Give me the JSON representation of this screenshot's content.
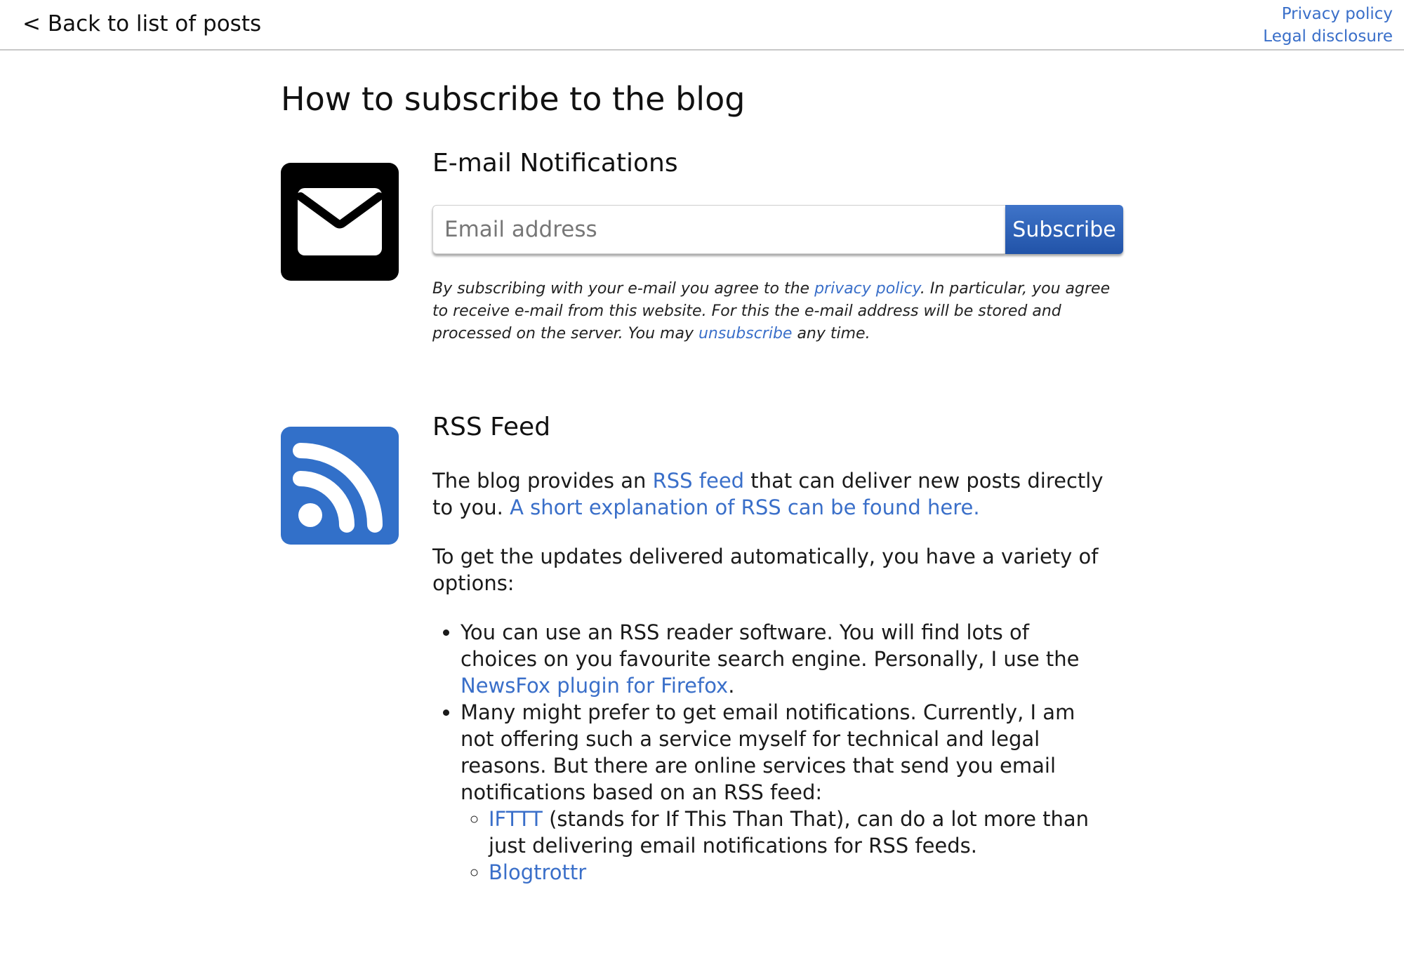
{
  "header": {
    "back_label": "< Back to list of posts",
    "privacy_label": "Privacy policy",
    "legal_label": "Legal disclosure"
  },
  "page": {
    "title": "How to subscribe to the blog"
  },
  "email_section": {
    "icon": "envelope-icon",
    "title": "E-mail Notifications",
    "input_placeholder": "Email address",
    "input_value": "",
    "subscribe_label": "Subscribe",
    "disclaimer_part1": "By subscribing with your e-mail you agree to the ",
    "disclaimer_privacy_link": "privacy policy",
    "disclaimer_part2": ". In particular, you agree to receive e-mail from this website. For this the e-mail address will be stored and processed on the server. You may ",
    "disclaimer_unsubscribe_link": "unsubscribe",
    "disclaimer_part3": " any time."
  },
  "rss_section": {
    "icon": "rss-icon",
    "title": "RSS Feed",
    "p1_part1": "The blog provides an ",
    "p1_rss_link": "RSS feed",
    "p1_part2": " that can deliver new posts directly to you. ",
    "p1_explain_link": "A short explanation of RSS can be found here.",
    "p2": "To get the updates delivered automatically, you have a variety of options:",
    "bullet1_part1": "You can use an RSS reader software. You will find lots of choices on you favourite search engine. Personally, I use the ",
    "bullet1_link": "NewsFox plugin for Firefox",
    "bullet1_part2": ".",
    "bullet2_text": "Many might prefer to get email notifications. Currently, I am not offering such a service myself for technical and legal reasons. But there are online services that send you email notifications based on an RSS feed:",
    "sub1_link": "IFTTT",
    "sub1_text": " (stands for If This Than That), can do a lot more than just delivering email notifications for RSS feeds.",
    "sub2_link": "Blogtrottr"
  },
  "colors": {
    "link": "#3a6fc9",
    "rss_icon_bg": "#3270c9",
    "mail_icon_bg": "#000000",
    "button_bg": "#2b5fb5"
  }
}
